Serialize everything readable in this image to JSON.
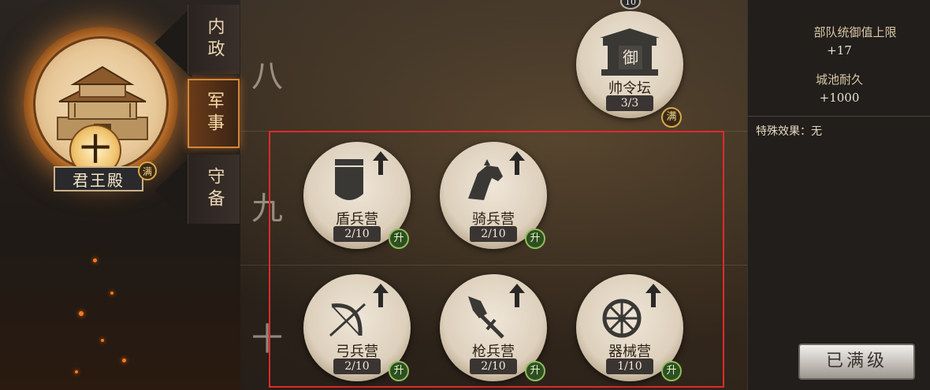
{
  "main_hall": {
    "name": "君王殿",
    "level_glyph": "十",
    "max_badge": "满"
  },
  "tabs": [
    {
      "label": "内政",
      "state": "inactive"
    },
    {
      "label": "军事",
      "state": "active"
    },
    {
      "label": "守备",
      "state": "inactive"
    }
  ],
  "tiers": [
    "八",
    "九",
    "十"
  ],
  "command_altar": {
    "level": "10",
    "name": "帅令坛",
    "count": "3/3",
    "badge": "满",
    "plaque": "御"
  },
  "camps": [
    {
      "name": "盾兵营",
      "count": "2/10",
      "badge": "升",
      "icon": "shield-icon"
    },
    {
      "name": "骑兵营",
      "count": "2/10",
      "badge": "升",
      "icon": "horse-icon"
    },
    {
      "name": "弓兵营",
      "count": "2/10",
      "badge": "升",
      "icon": "bow-icon"
    },
    {
      "name": "枪兵营",
      "count": "2/10",
      "badge": "升",
      "icon": "spear-icon"
    },
    {
      "name": "器械营",
      "count": "1/10",
      "badge": "升",
      "icon": "wheel-icon"
    }
  ],
  "stats": {
    "troop_label": "部队统御值上限",
    "troop_value": "+17",
    "durability_label": "城池耐久",
    "durability_value": "+1000",
    "special": "特殊效果：无"
  },
  "button": {
    "label": "已满级"
  },
  "colors": {
    "highlight": "#e02a2a",
    "upgrade_badge": "#2d4f22",
    "active_tab": "#d2873a"
  }
}
